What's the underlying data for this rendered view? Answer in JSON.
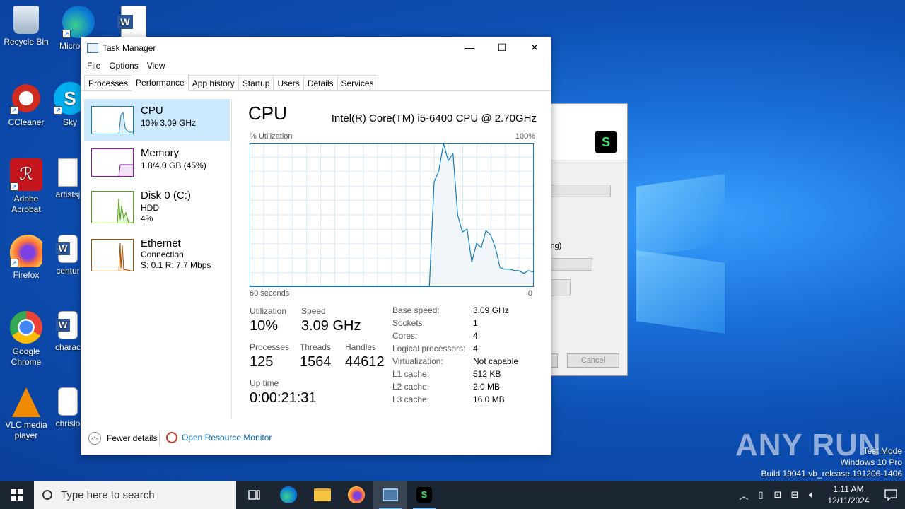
{
  "desktop": {
    "icons": [
      {
        "label": "Recycle Bin"
      },
      {
        "label": "Micro Edg"
      },
      {
        "label": "CCleaner"
      },
      {
        "label": "Sky"
      },
      {
        "label": "Adobe Acrobat"
      },
      {
        "label": "artistsj"
      },
      {
        "label": "Firefox"
      },
      {
        "label": "centur"
      },
      {
        "label": "Google Chrome"
      },
      {
        "label": "charac"
      },
      {
        "label": "VLC media player"
      },
      {
        "label": "chrislo"
      }
    ],
    "watermark": "ANY RUN",
    "test_mode": {
      "line1": "Test Mode",
      "line2": "Windows 10 Pro",
      "line3": "Build 19041.vb_release.191206-1406"
    }
  },
  "bg_dialog": {
    "partial_text": "ing)",
    "cancel_label": "Cancel"
  },
  "window": {
    "title": "Task Manager",
    "minimize": "—",
    "maximize": "☐",
    "close": "✕"
  },
  "menu": [
    "File",
    "Options",
    "View"
  ],
  "tabs": [
    "Processes",
    "Performance",
    "App history",
    "Startup",
    "Users",
    "Details",
    "Services"
  ],
  "active_tab": "Performance",
  "sidebar": [
    {
      "name": "CPU",
      "line1": "10%  3.09 GHz",
      "line2": "",
      "color": "#117dbb"
    },
    {
      "name": "Memory",
      "line1": "1.8/4.0 GB (45%)",
      "line2": "",
      "color": "#8b12ae"
    },
    {
      "name": "Disk 0 (C:)",
      "line1": "HDD",
      "line2": "4%",
      "color": "#4da60c"
    },
    {
      "name": "Ethernet",
      "line1": "Connection",
      "line2": "S: 0.1  R: 7.7 Mbps",
      "color": "#a74f01"
    }
  ],
  "cpu": {
    "title": "CPU",
    "model": "Intel(R) Core(TM) i5-6400 CPU @ 2.70GHz",
    "util_label": "% Utilization",
    "util_max": "100%",
    "time_left": "60 seconds",
    "time_right": "0",
    "stats": {
      "utilization_label": "Utilization",
      "utilization": "10%",
      "speed_label": "Speed",
      "speed": "3.09 GHz",
      "processes_label": "Processes",
      "processes": "125",
      "threads_label": "Threads",
      "threads": "1564",
      "handles_label": "Handles",
      "handles": "44612",
      "uptime_label": "Up time",
      "uptime": "0:00:21:31"
    },
    "specs": [
      {
        "k": "Base speed:",
        "v": "3.09 GHz"
      },
      {
        "k": "Sockets:",
        "v": "1"
      },
      {
        "k": "Cores:",
        "v": "4"
      },
      {
        "k": "Logical processors:",
        "v": "4"
      },
      {
        "k": "Virtualization:",
        "v": "Not capable"
      },
      {
        "k": "L1 cache:",
        "v": "512 KB"
      },
      {
        "k": "L2 cache:",
        "v": "2.0 MB"
      },
      {
        "k": "L3 cache:",
        "v": "16.0 MB"
      }
    ]
  },
  "chart_data": {
    "type": "area",
    "ylim": [
      0,
      100
    ],
    "xlim": [
      0,
      60
    ],
    "grid": true,
    "color": "#117dbb",
    "x": [
      0,
      38,
      39,
      40,
      41,
      42,
      43,
      44,
      45,
      46,
      47,
      48,
      49,
      50,
      51,
      52,
      53,
      54,
      55,
      56,
      57,
      58,
      59,
      60
    ],
    "y": [
      0,
      0,
      73,
      81,
      100,
      88,
      93,
      50,
      38,
      40,
      17,
      30,
      27,
      39,
      36,
      27,
      13,
      12,
      12,
      11,
      11,
      9,
      11,
      10
    ]
  },
  "footer": {
    "fewer_details": "Fewer details",
    "open_rm": "Open Resource Monitor"
  },
  "taskbar": {
    "search_placeholder": "Type here to search",
    "time": "1:11 AM",
    "date": "12/11/2024"
  }
}
